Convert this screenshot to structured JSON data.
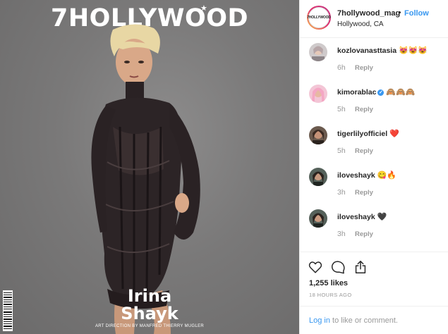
{
  "cover": {
    "masthead": "7HOLLYWOOD",
    "first_name": "Irina",
    "last_name": "Shayk",
    "credit": "ART DIRECTION BY MANFRED THIERRY MUGLER"
  },
  "post": {
    "username": "7hollywood_mag",
    "separator": "•",
    "follow_label": "Follow",
    "location": "Hollywood, CA",
    "avatar_text": "7HOLLYWOOD"
  },
  "comments": [
    {
      "user": "kozlovanasttasia",
      "emoji": "😻😻😻",
      "verified": false,
      "time": "6h",
      "reply": "Reply"
    },
    {
      "user": "kimorablac",
      "emoji": "🙈🙈🙈",
      "verified": true,
      "time": "5h",
      "reply": "Reply"
    },
    {
      "user": "tigerlilyofficiel",
      "emoji": "❤️",
      "verified": false,
      "time": "5h",
      "reply": "Reply"
    },
    {
      "user": "iloveshayk",
      "emoji": "😋🔥",
      "verified": false,
      "time": "3h",
      "reply": "Reply"
    },
    {
      "user": "iloveshayk",
      "emoji": "🖤",
      "verified": false,
      "time": "3h",
      "reply": "Reply"
    }
  ],
  "actions": {
    "likes": "1,255 likes",
    "timestamp": "18 HOURS AGO"
  },
  "login": {
    "link": "Log in",
    "rest": " to like or comment."
  },
  "colors": {
    "link_blue": "#3897f0",
    "muted_gray": "#999999",
    "text": "#262626"
  },
  "icons": [
    "heart-icon",
    "comment-icon",
    "share-icon"
  ]
}
